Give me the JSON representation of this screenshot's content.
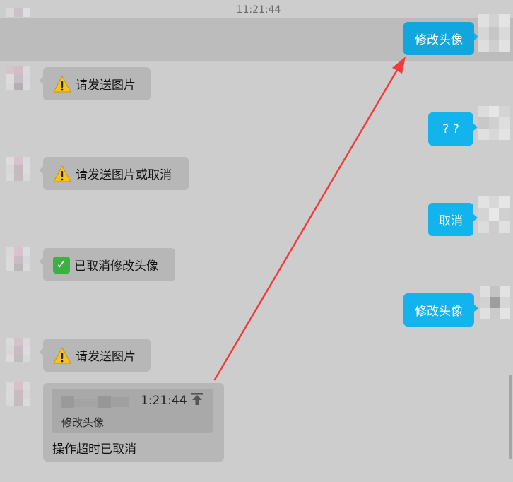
{
  "timestamp": "11:21:44",
  "highlighted_message": {
    "text": "修改头像"
  },
  "incoming": [
    {
      "icon": "warning-icon",
      "text": "请发送图片"
    },
    {
      "icon": "warning-icon",
      "text": "请发送图片或取消"
    },
    {
      "icon": "check-icon",
      "text": "已取消修改头像"
    },
    {
      "icon": "warning-icon",
      "text": "请发送图片"
    }
  ],
  "outgoing": [
    {
      "text": "? ?"
    },
    {
      "text": "取消"
    },
    {
      "text": "修改头像"
    }
  ],
  "reply_message": {
    "quote_time": "1:21:44",
    "quote_text": "修改头像",
    "text": "操作超时已取消"
  },
  "colors": {
    "outgoing_bubble": "#13b4ed",
    "incoming_bubble": "#b7b7b7",
    "annotation_arrow": "#f03c3c"
  }
}
